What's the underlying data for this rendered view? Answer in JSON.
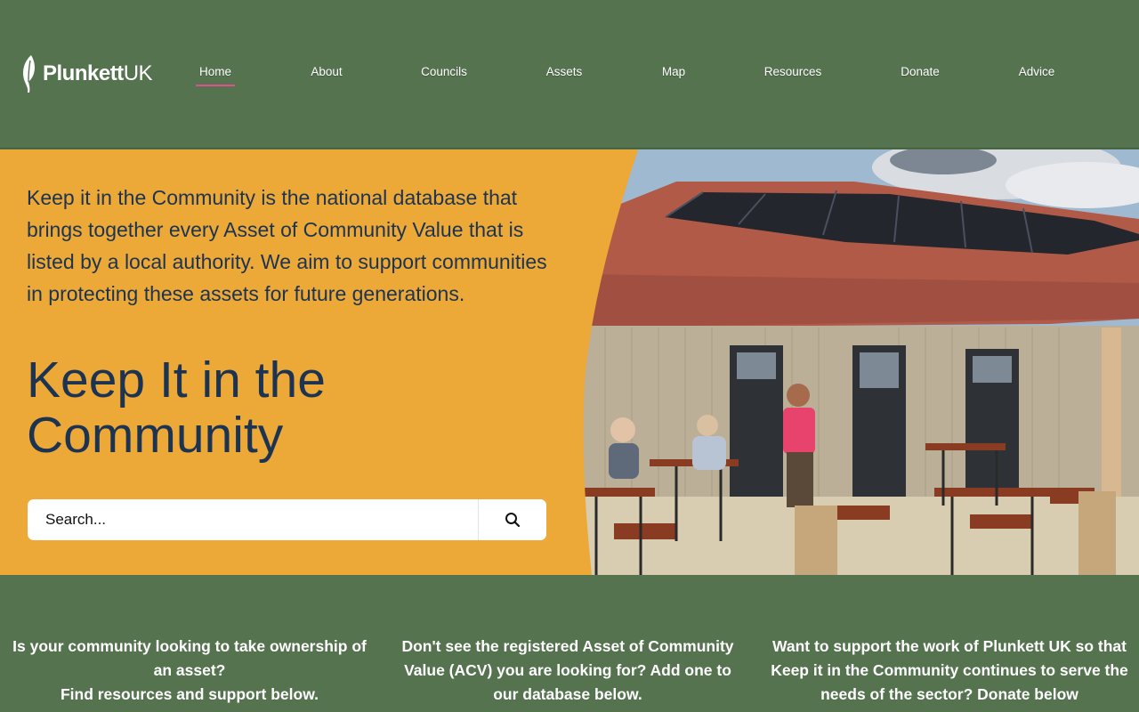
{
  "brand": {
    "name": "Plunkett",
    "suffix": "UK"
  },
  "nav": {
    "items": [
      {
        "label": "Home",
        "active": true
      },
      {
        "label": "About"
      },
      {
        "label": "Councils"
      },
      {
        "label": "Assets"
      },
      {
        "label": "Map"
      },
      {
        "label": "Resources"
      },
      {
        "label": "Donate"
      },
      {
        "label": "Advice"
      }
    ]
  },
  "hero": {
    "intro": "Keep it in the Community is the national database that brings together every Asset of Community Value that is listed by a local authority. We aim to support communities in protecting these assets for future generations.",
    "title": "Keep It in the Community",
    "search": {
      "placeholder": "Search...",
      "icon": "search-icon"
    }
  },
  "cta": {
    "left_line1": "Is your community looking to take ownership of an asset?",
    "left_line2": "Find resources and support below.",
    "middle": "Don't see the registered Asset of Community Value (ACV) you are looking for? Add one to our database below.",
    "right": "Want to support the work of Plunkett UK so that Keep it in the Community continues to serve the needs of the sector? Donate below"
  },
  "colors": {
    "green": "#55734f",
    "amber": "#eca937",
    "navy": "#1d3352",
    "accent": "#e2508f"
  }
}
